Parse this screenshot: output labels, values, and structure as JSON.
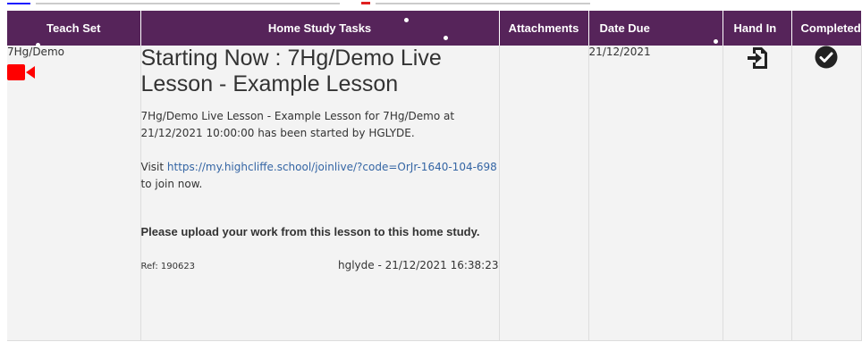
{
  "table": {
    "headers": {
      "teach_set": "Teach Set",
      "home_study_tasks": "Home Study Tasks",
      "attachments": "Attachments",
      "date_due": "Date Due",
      "hand_in": "Hand In",
      "completed": "Completed"
    },
    "row": {
      "teach_set": "7Hg/Demo",
      "teach_set_icon": "video-camera-icon",
      "title": "Starting Now : 7Hg/Demo Live Lesson - Example Lesson",
      "description": "7Hg/Demo Live Lesson - Example Lesson for 7Hg/Demo at 21/12/2021 10:00:00 has been started by HGLYDE.",
      "visit_prefix": "Visit",
      "link": "https://my.highcliffe.school/joinlive/?code=OrJr-1640-104-698",
      "visit_suffix": "to join now.",
      "instruction": "Please upload your work from this lesson to this home study.",
      "ref": "Ref: 190623",
      "author_stamp": "hglyde - 21/12/2021 16:38:23",
      "attachments": "",
      "date_due": "21/12/2021",
      "hand_in_icon": "hand-in-icon",
      "completed_icon": "check-circle-icon"
    }
  },
  "colors": {
    "header_bg": "#56245a",
    "header_text": "#ffffff",
    "row_bg": "#f3f3f3",
    "link": "#3465a4",
    "video_icon": "#ff0000"
  }
}
